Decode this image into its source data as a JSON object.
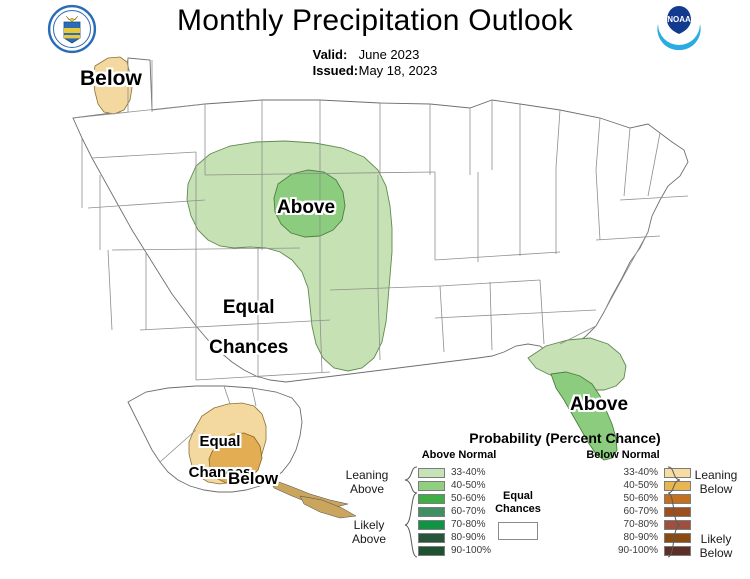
{
  "header": {
    "title": "Monthly Precipitation Outlook",
    "valid_label": "Valid:",
    "valid_value": "June 2023",
    "issued_label": "Issued:",
    "issued_value": "May 18, 2023",
    "left_logo": "department-of-commerce-seal",
    "right_logo": "noaa-logo",
    "noaa_text": "NOAA"
  },
  "map_labels": {
    "northwest_below": "Below",
    "central_above": "Above",
    "central_equal_line1": "Equal",
    "central_equal_line2": "Chances",
    "florida_above": "Above",
    "alaska_equal_line1": "Equal",
    "alaska_equal_line2": "Chances",
    "alaska_below": "Below"
  },
  "legend": {
    "title": "Probability (Percent Chance)",
    "above_header": "Above Normal",
    "below_header": "Below Normal",
    "equal_chances_line1": "Equal",
    "equal_chances_line2": "Chances",
    "equal_chances_color": "#ffffff",
    "groups": {
      "leaning_above_line1": "Leaning",
      "leaning_above_line2": "Above",
      "likely_above_line1": "Likely",
      "likely_above_line2": "Above",
      "leaning_below_line1": "Leaning",
      "leaning_below_line2": "Below",
      "likely_below_line1": "Likely",
      "likely_below_line2": "Below"
    },
    "above_items": [
      {
        "range": "33-40%",
        "color": "#c5e3b6"
      },
      {
        "range": "40-50%",
        "color": "#8fcf7f"
      },
      {
        "range": "50-60%",
        "color": "#3fae44"
      },
      {
        "range": "60-70%",
        "color": "#3f8f63"
      },
      {
        "range": "70-80%",
        "color": "#109444"
      },
      {
        "range": "80-90%",
        "color": "#28543c"
      },
      {
        "range": "90-100%",
        "color": "#1d5130"
      }
    ],
    "below_items": [
      {
        "range": "33-40%",
        "color": "#f7dda4"
      },
      {
        "range": "40-50%",
        "color": "#e8b553"
      },
      {
        "range": "50-60%",
        "color": "#c4701f"
      },
      {
        "range": "60-70%",
        "color": "#9c4f1e"
      },
      {
        "range": "70-80%",
        "color": "#9e4f3d"
      },
      {
        "range": "80-90%",
        "color": "#8a4a10"
      },
      {
        "range": "90-100%",
        "color": "#5e2f26"
      }
    ]
  },
  "map_regions": [
    {
      "name": "northwest-washington-below",
      "category": "below",
      "probability": "33-40%",
      "color": "#f3d9a0"
    },
    {
      "name": "central-plains-above-outer",
      "category": "above",
      "probability": "33-40%",
      "color": "#c6e2b4"
    },
    {
      "name": "central-plains-above-inner",
      "category": "above",
      "probability": "40-50%",
      "color": "#8ccc7e"
    },
    {
      "name": "southeast-florida-above-outer",
      "category": "above",
      "probability": "33-40%",
      "color": "#c6e2b4"
    },
    {
      "name": "southeast-florida-above-inner",
      "category": "above",
      "probability": "40-50%",
      "color": "#8ccc7e"
    },
    {
      "name": "alaska-below-outer",
      "category": "below",
      "probability": "33-40%",
      "color": "#f3d9a0"
    },
    {
      "name": "alaska-below-inner",
      "category": "below",
      "probability": "40-50%",
      "color": "#e3ad54"
    },
    {
      "name": "conus-remainder",
      "category": "equal-chances",
      "probability": "",
      "color": "#ffffff"
    }
  ]
}
